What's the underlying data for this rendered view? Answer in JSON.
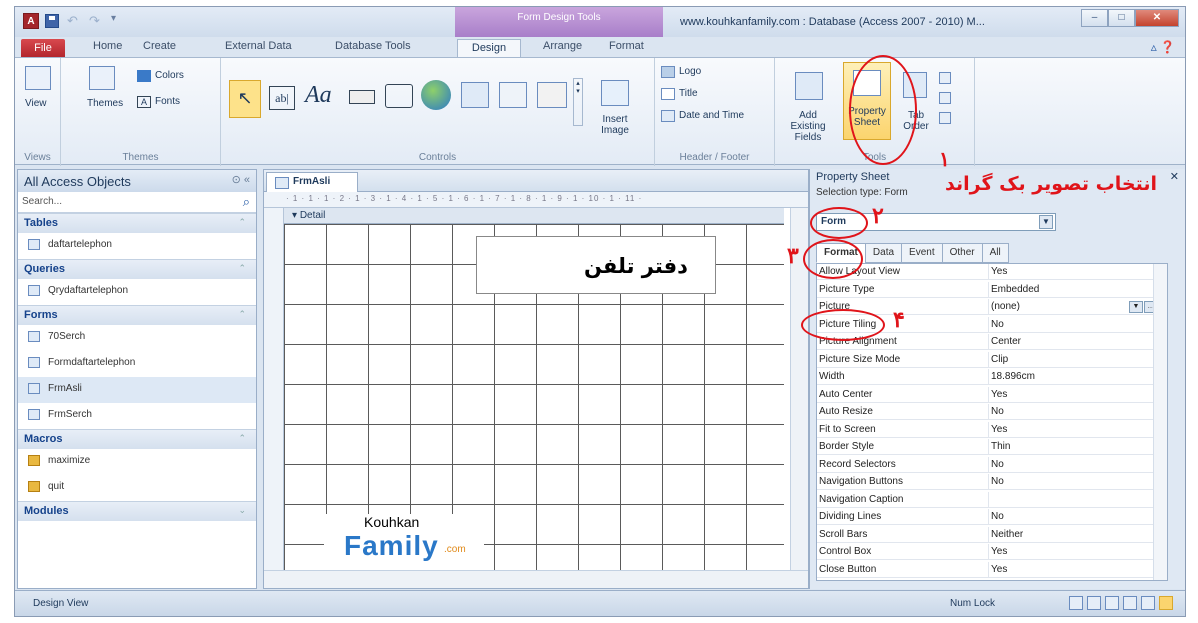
{
  "title_bar": {
    "app_icon": "A",
    "context_group": "Form Design Tools",
    "window_title": "www.kouhkanfamily.com : Database (Access 2007 - 2010) M...",
    "buttons": [
      "–",
      "□",
      "✕"
    ]
  },
  "tabs": [
    "File",
    "Home",
    "Create",
    "External Data",
    "Database Tools",
    "Design",
    "Arrange",
    "Format"
  ],
  "ribbon": {
    "views": {
      "view_label": "View",
      "group_label": "Views"
    },
    "themes": {
      "themes_label": "Themes",
      "colors_label": "Colors",
      "fonts_label": "Fonts",
      "group_label": "Themes"
    },
    "controls": {
      "group_label": "Controls",
      "insert_image_label": "Insert Image"
    },
    "header_footer": {
      "logo_label": "Logo",
      "title_label": "Title",
      "date_time_label": "Date and Time",
      "group_label": "Header / Footer"
    },
    "tools": {
      "add_fields_label": "Add Existing Fields",
      "property_sheet_label": "Property Sheet",
      "tab_order_label": "Tab Order",
      "group_label": "Tools"
    }
  },
  "nav_pane": {
    "header": "All Access Objects",
    "search_placeholder": "Search...",
    "sections": [
      {
        "name": "Tables",
        "items": [
          "daftartelephon"
        ]
      },
      {
        "name": "Queries",
        "items": [
          "Qrydaftartelephon"
        ]
      },
      {
        "name": "Forms",
        "items": [
          "70Serch",
          "Formdaftartelephon",
          "FrmAsli",
          "FrmSerch"
        ]
      },
      {
        "name": "Macros",
        "items": [
          "maximize",
          "quit"
        ]
      },
      {
        "name": "Modules",
        "items": []
      }
    ]
  },
  "document": {
    "tab_label": "FrmAsli",
    "detail_label": "Detail",
    "form_title": "دفتر تلفن",
    "logo": {
      "top": "Kouhkan",
      "main": "Family",
      "suffix": ".com"
    },
    "ruler_text": "· 1 · 1 · 1 · 2 · 1 · 3 · 1 · 4 · 1 · 5 · 1 · 6 · 1 · 7 · 1 · 8 · 1 · 9 · 1 · 10 · 1 · 11 ·"
  },
  "property_sheet": {
    "title": "Property Sheet",
    "selection_type": "Selection type:  Form",
    "selected_object": "Form",
    "tabs": [
      "Format",
      "Data",
      "Event",
      "Other",
      "All"
    ],
    "rows": [
      {
        "name": "Allow Layout View",
        "value": "Yes"
      },
      {
        "name": "Picture Type",
        "value": "Embedded"
      },
      {
        "name": "Picture",
        "value": "(none)"
      },
      {
        "name": "Picture Tiling",
        "value": "No"
      },
      {
        "name": "Picture Alignment",
        "value": "Center"
      },
      {
        "name": "Picture Size Mode",
        "value": "Clip"
      },
      {
        "name": "Width",
        "value": "18.896cm"
      },
      {
        "name": "Auto Center",
        "value": "Yes"
      },
      {
        "name": "Auto Resize",
        "value": "No"
      },
      {
        "name": "Fit to Screen",
        "value": "Yes"
      },
      {
        "name": "Border Style",
        "value": "Thin"
      },
      {
        "name": "Record Selectors",
        "value": "No"
      },
      {
        "name": "Navigation Buttons",
        "value": "No"
      },
      {
        "name": "Navigation Caption",
        "value": ""
      },
      {
        "name": "Dividing Lines",
        "value": "No"
      },
      {
        "name": "Scroll Bars",
        "value": "Neither"
      },
      {
        "name": "Control Box",
        "value": "Yes"
      },
      {
        "name": "Close Button",
        "value": "Yes"
      }
    ]
  },
  "annotations": {
    "heading": "انتخاب تصویر بک گراند",
    "step1": "۱",
    "step2": "۲",
    "step3": "۳",
    "step4": "۴"
  },
  "status_bar": {
    "left": "Design View",
    "right": "Num Lock"
  },
  "colors": {
    "annotation_red": "#e0141a",
    "file_tab_red": "#b3262d",
    "context_purple": "#a87ec9"
  }
}
